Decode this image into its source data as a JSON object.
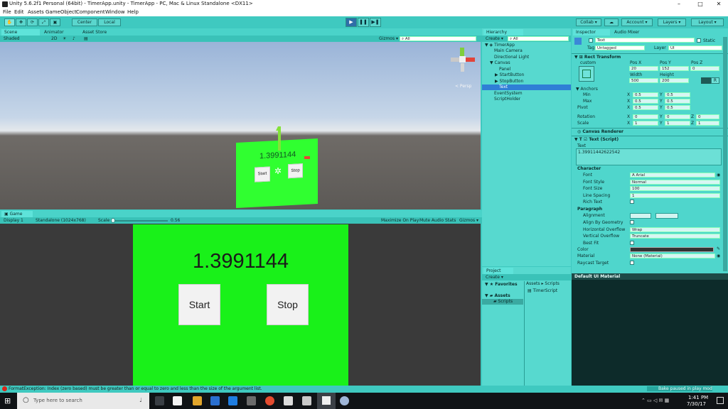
{
  "window": {
    "title": "Unity 5.6.2f1 Personal (64bit) - TimerApp.unity - TimerApp - PC, Mac & Linux Standalone <DX11>",
    "controls": {
      "minimize": "–",
      "maximize": "□",
      "close": "✕"
    }
  },
  "menubar": [
    "File",
    "Edit",
    "Assets",
    "GameObject",
    "Component",
    "Window",
    "Help"
  ],
  "toolbar": {
    "center": "Center",
    "local": "Local",
    "collab": "Collab ▾",
    "account": "Account ▾",
    "layers": "Layers ▾",
    "layout": "Layout ▾",
    "play": "▶",
    "pause": "❚❚",
    "step": "▶❚"
  },
  "scene": {
    "tabs": [
      "Scene",
      "Animator",
      "Asset Store"
    ],
    "shading": "Shaded",
    "mode2d": "2D",
    "gizmos": "Gizmos ▾",
    "search_placeholder": "All",
    "persp": "< Persp",
    "canvas_text": "1.3991144",
    "start": "Start",
    "stop": "Stop"
  },
  "game": {
    "tab": "Game",
    "display": "Display 1",
    "resolution": "Standalone (1024x768)",
    "scale_label": "Scale",
    "scale_value": "0.56",
    "maximize": "Maximize On Play",
    "mute": "Mute Audio",
    "stats": "Stats",
    "gizmos": "Gizmos ▾",
    "timer_text": "1.3991144",
    "start_label": "Start",
    "stop_label": "Stop"
  },
  "hierarchy": {
    "tab": "Hierarchy",
    "create": "Create ▾",
    "search_placeholder": "All",
    "items": [
      {
        "label": "TimerApp"
      },
      {
        "label": "Main Camera"
      },
      {
        "label": "Directional Light"
      },
      {
        "label": "Canvas"
      },
      {
        "label": "Panel"
      },
      {
        "label": "StartButton"
      },
      {
        "label": "StopButton"
      },
      {
        "label": "Text"
      },
      {
        "label": "EventSystem"
      },
      {
        "label": "ScriptHolder"
      }
    ]
  },
  "project": {
    "tab": "Project",
    "create": "Create ▾",
    "favorites": "Favorites",
    "assets": "Assets",
    "scripts": "Scripts",
    "breadcrumb_assets": "Assets",
    "breadcrumb_sep": "▸",
    "breadcrumb_scripts": "Scripts",
    "file": "TimerScript"
  },
  "inspector": {
    "tabs": [
      "Inspector",
      "Audio Mixer"
    ],
    "object_name": "Text",
    "static": "Static",
    "tag_label": "Tag",
    "tag_value": "Untagged",
    "layer_label": "Layer",
    "layer_value": "UI",
    "rect_transform": "Rect Transform",
    "custom": "custom",
    "posx_label": "Pos X",
    "posx": "20",
    "posy_label": "Pos Y",
    "posy": "152",
    "posz_label": "Pos Z",
    "posz": "0",
    "width_label": "Width",
    "width": "500",
    "height_label": "Height",
    "height": "200",
    "r": "R",
    "anchors": "Anchors",
    "min_label": "Min",
    "max_label": "Max",
    "pivot_label": "Pivot",
    "x_label": "X",
    "y_label": "Y",
    "z_label": "Z",
    "min_x": "0.5",
    "min_y": "0.5",
    "max_x": "0.5",
    "max_y": "0.5",
    "pivot_x": "0.5",
    "pivot_y": "0.5",
    "rotation_label": "Rotation",
    "rot_x": "0",
    "rot_y": "0",
    "rot_z": "0",
    "scale_label": "Scale",
    "scale_x": "1",
    "scale_y": "1",
    "scale_z": "1",
    "canvas_renderer": "Canvas Renderer",
    "text_script": "Text (Script)",
    "text_label": "Text",
    "text_value": "1.39911442622542",
    "character": "Character",
    "font_label": "Font",
    "font_value": "Arial",
    "font_style_label": "Font Style",
    "font_style_value": "Normal",
    "font_size_label": "Font Size",
    "font_size_value": "100",
    "line_spacing_label": "Line Spacing",
    "line_spacing_value": "1",
    "rich_text_label": "Rich Text",
    "paragraph": "Paragraph",
    "alignment_label": "Alignment",
    "align_geom_label": "Align By Geometry",
    "hoverflow_label": "Horizontal Overflow",
    "hoverflow_value": "Wrap",
    "voverflow_label": "Vertical Overflow",
    "voverflow_value": "Truncate",
    "best_fit_label": "Best Fit",
    "color_label": "Color",
    "material_label": "Material",
    "material_value": "None (Material)",
    "raycast_label": "Raycast Target",
    "default_material": "Default UI Material"
  },
  "status": {
    "error": "FormatException: Index (zero based) must be greater than or equal to zero and less than the size of the argument list.",
    "bake": "Bake paused in play mode"
  },
  "taskbar": {
    "search_placeholder": "Type here to search",
    "time": "1:41 PM",
    "date": "7/30/17"
  }
}
